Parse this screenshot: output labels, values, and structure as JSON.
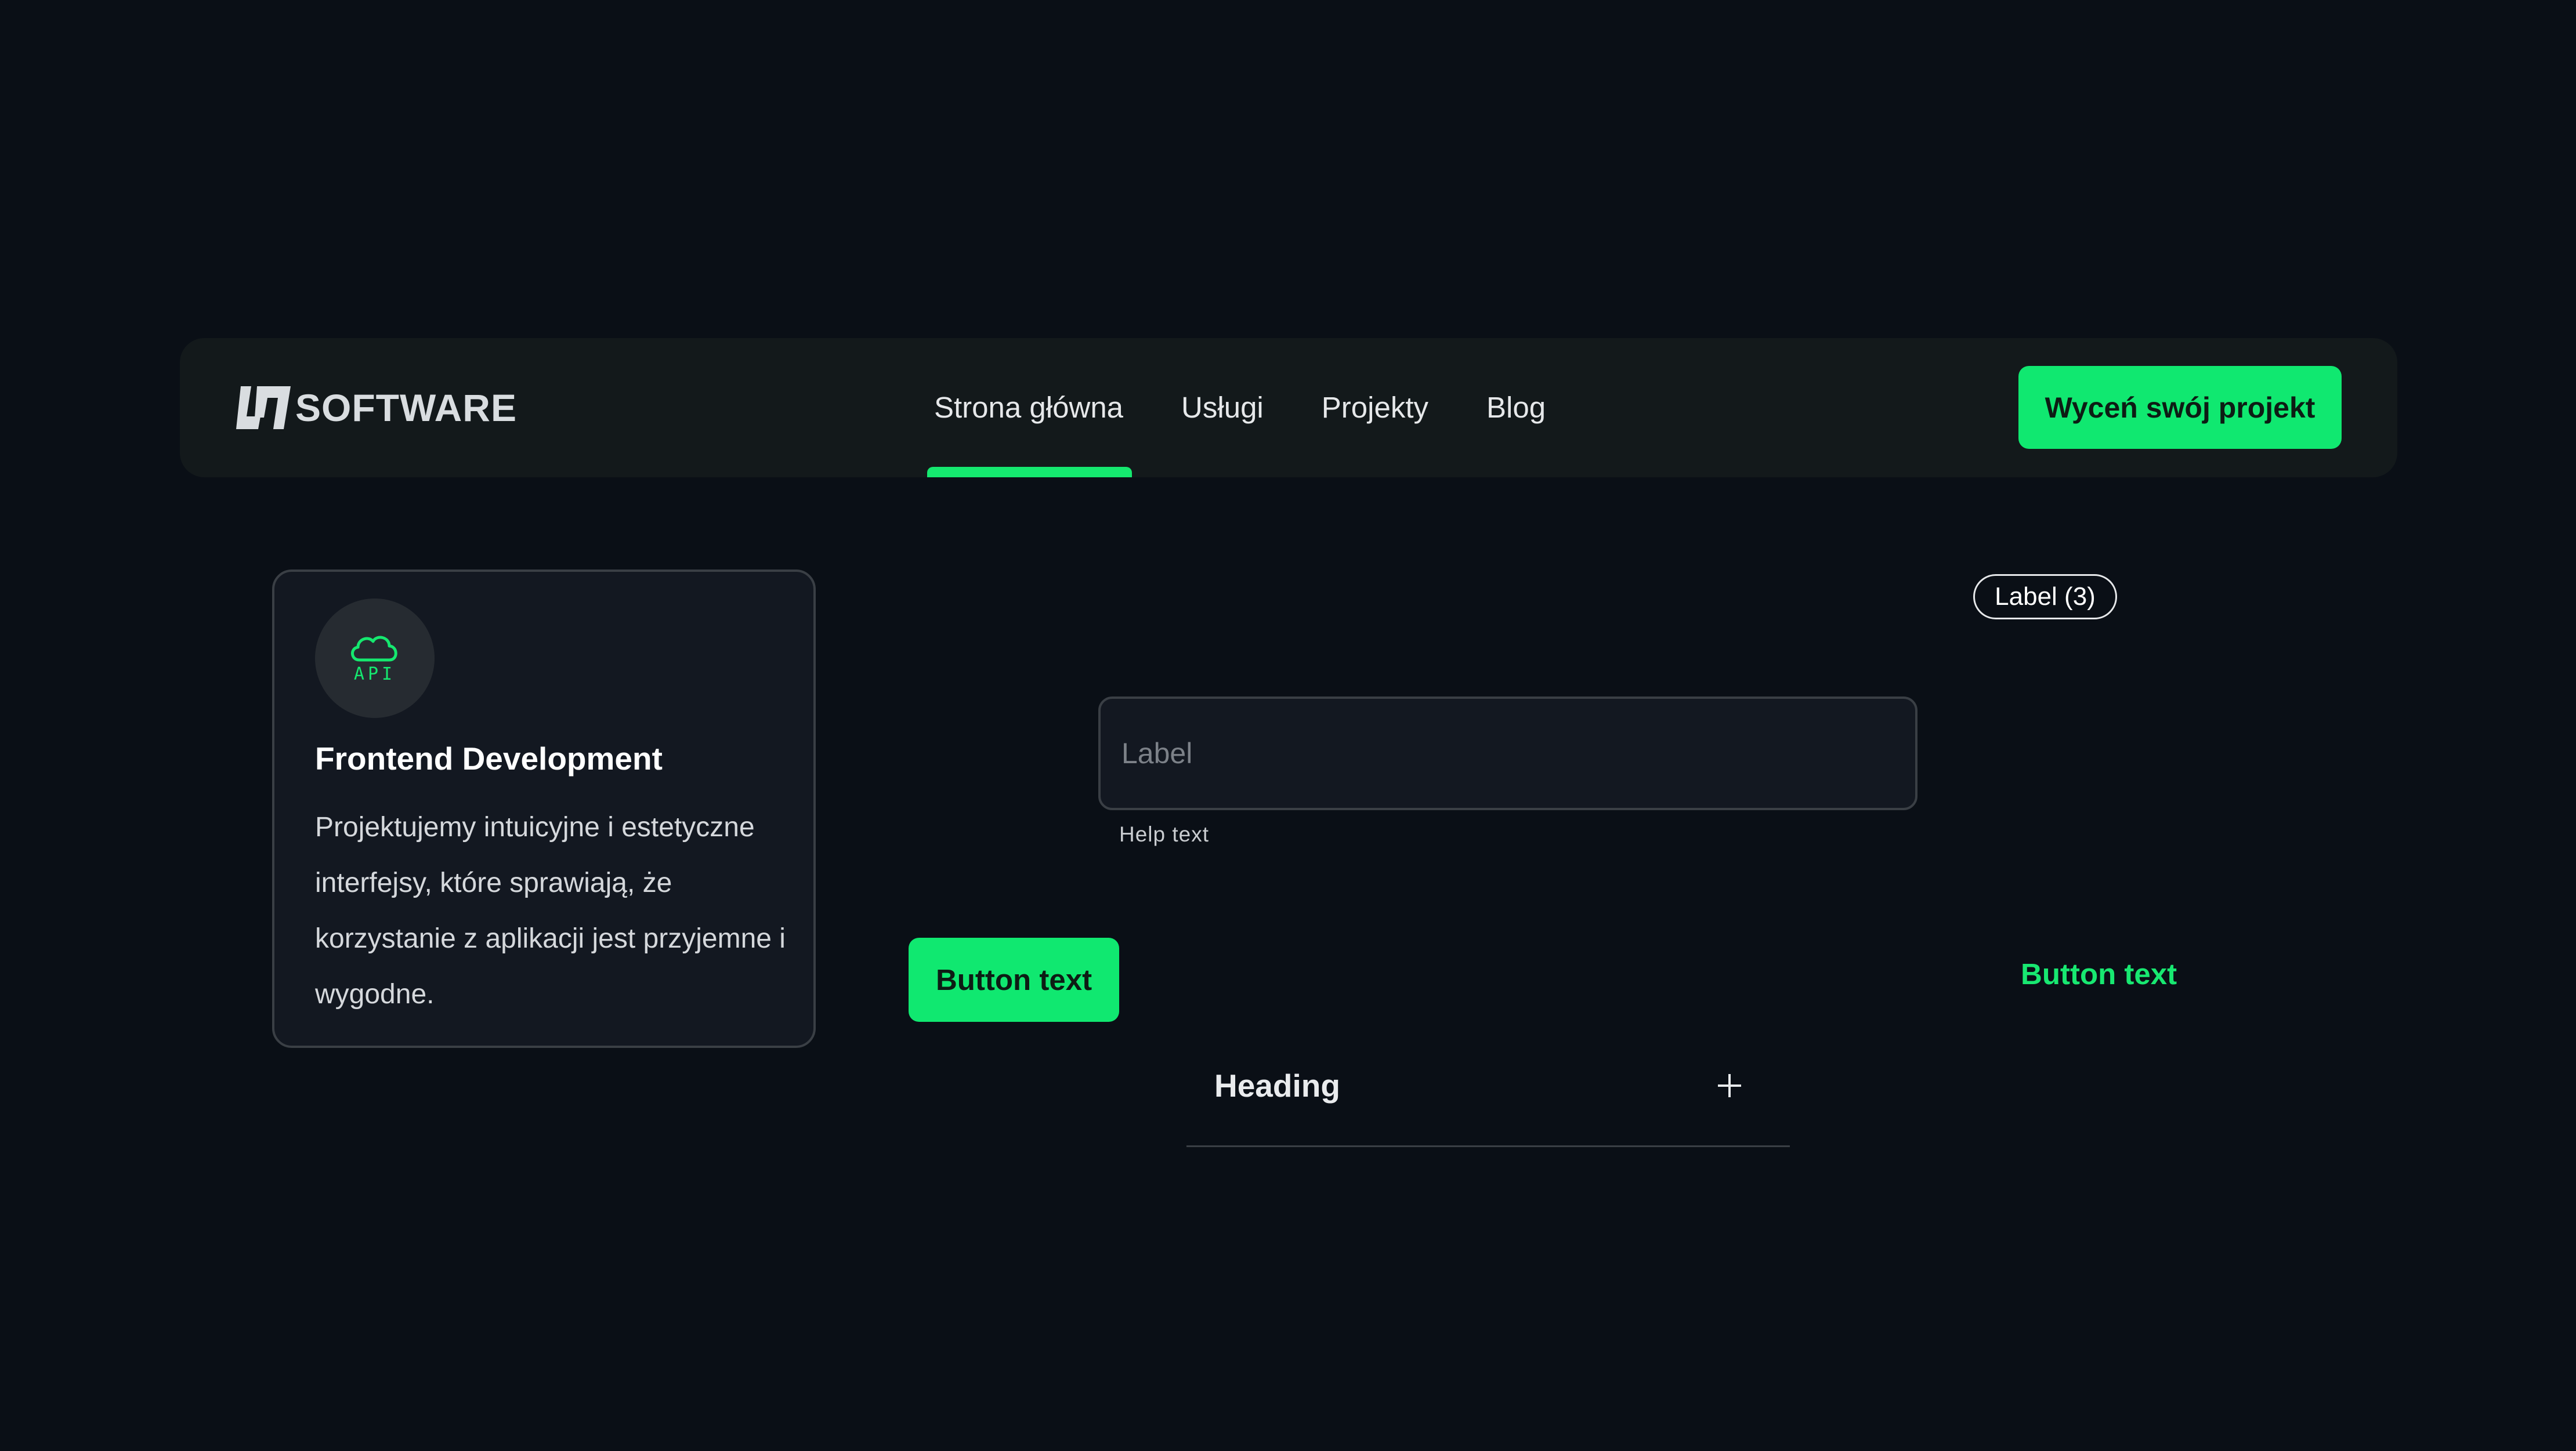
{
  "header": {
    "logo_text": "SOFTWARE",
    "nav": [
      "Strona główna",
      "Usługi",
      "Projekty",
      "Blog"
    ],
    "active_nav": "Strona główna",
    "cta_label": "Wyceń swój projekt"
  },
  "card": {
    "icon": "cloud-api-icon",
    "icon_text": "API",
    "title": "Frontend Development",
    "body": "Projektujemy intuicyjne i estetyczne interfejsy, które sprawiają, że korzystanie z aplikacji jest przyjemne i wygodne."
  },
  "chip": {
    "label": "Label (3)"
  },
  "field": {
    "placeholder": "Label",
    "value": "",
    "help": "Help text"
  },
  "buttons": {
    "primary_label": "Button text",
    "text_label": "Button text"
  },
  "accordion": {
    "heading": "Heading",
    "toggle_icon": "plus-icon"
  },
  "colors": {
    "background": "#0a0f16",
    "surface": "#13191b",
    "card": "#131821",
    "accent": "#10e870",
    "border": "#3a3f45"
  }
}
